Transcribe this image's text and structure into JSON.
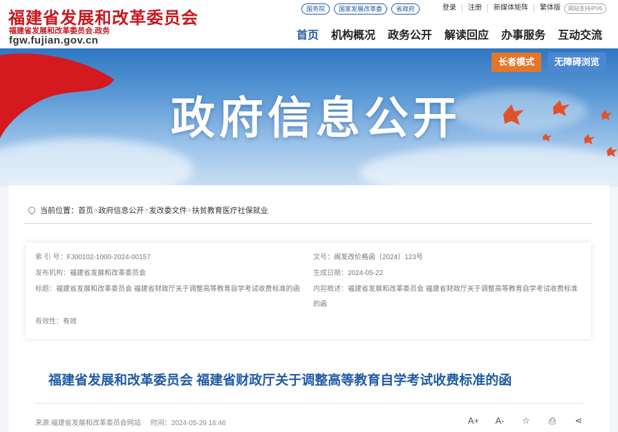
{
  "header": {
    "title": "福建省发展和改革委员会",
    "subtitle": "福建省发展和改革委员会.政务",
    "domain": "fgw.fujian.gov.cn",
    "quick_links": [
      "国务院",
      "国家发展改革委",
      "省政府"
    ],
    "top_links": [
      "登录",
      "注册",
      "新媒体矩阵",
      "繁体版"
    ],
    "ipv6_badge": "网站支持IPV6",
    "nav": [
      "首页",
      "机构概况",
      "政务公开",
      "解读回应",
      "办事服务",
      "互动交流"
    ],
    "active_nav": "首页"
  },
  "banner": {
    "title": "政府信息公开",
    "elder_mode": "长者模式",
    "accessible_mode": "无障碍浏览",
    "colors": {
      "elder": "#e4762a",
      "accessible": "#4b88d0"
    }
  },
  "breadcrumb": {
    "prefix": "当前位置：",
    "items": [
      "首页",
      "政府信息公开",
      "发改委文件",
      "扶贫教育医疗社保就业"
    ],
    "separator": ">"
  },
  "meta": {
    "index_no": {
      "label": "索 引 号：",
      "value": "FJ00102-1000-2024-00157"
    },
    "doc_no": {
      "label": "文号：",
      "value": "闽发改价格函〔2024〕123号"
    },
    "publisher": {
      "label": "发布机构：",
      "value": "福建省发展和改革委员会"
    },
    "date": {
      "label": "生成日期：",
      "value": "2024-05-22"
    },
    "title": {
      "label": "标题：",
      "value": "福建省发展和改革委员会 福建省财政厅关于调整高等教育自学考试收费标准的函"
    },
    "summary": {
      "label": "内容概述：",
      "value": "福建省发展和改革委员会 福建省财政厅关于调整高等教育自学考试收费标准的函"
    },
    "validity": {
      "label": "有效性：",
      "value": "有效"
    }
  },
  "article": {
    "title": "福建省发展和改革委员会 福建省财政厅关于调整高等教育自学考试收费标准的函",
    "source_label": "来源:",
    "source": "福建省发展和改革委员会网站",
    "time_label": "时间：",
    "time": "2024-05-29 16:46",
    "tools": [
      "A+",
      "A-",
      "☆",
      "⎙",
      "⋖"
    ]
  },
  "colors": {
    "brand_red": "#c8161d",
    "brand_blue": "#1f5aa6"
  }
}
